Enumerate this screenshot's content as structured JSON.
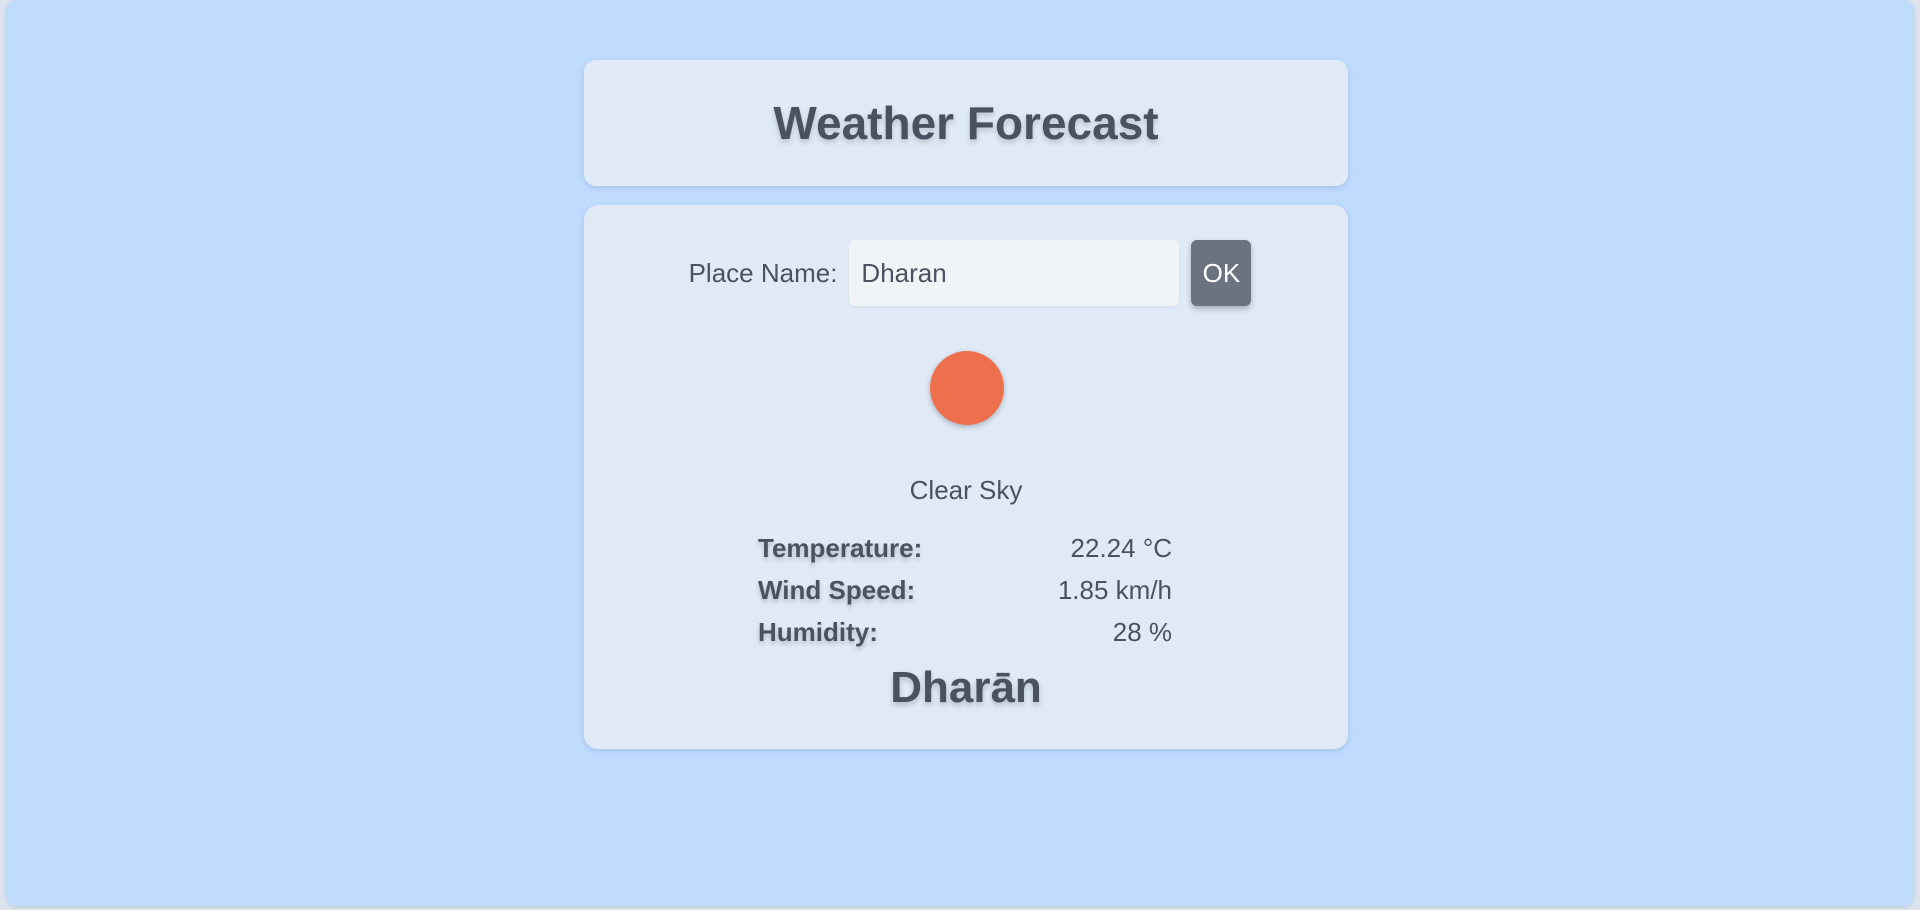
{
  "header": {
    "title": "Weather Forecast"
  },
  "search": {
    "label": "Place Name:",
    "value": "Dharan",
    "button_label": "OK"
  },
  "weather": {
    "icon": "sun-icon",
    "icon_color": "#ee6f4d",
    "condition": "Clear Sky",
    "stats": [
      {
        "label": "Temperature:",
        "value": "22.24 °C"
      },
      {
        "label": "Wind Speed:",
        "value": "1.85 km/h"
      },
      {
        "label": "Humidity:",
        "value": "28 %"
      }
    ],
    "city": "Dharān"
  },
  "colors": {
    "background": "#bfdbfe",
    "card": "#dfeaf6",
    "text": "#4a5261",
    "button": "#6b7280"
  }
}
